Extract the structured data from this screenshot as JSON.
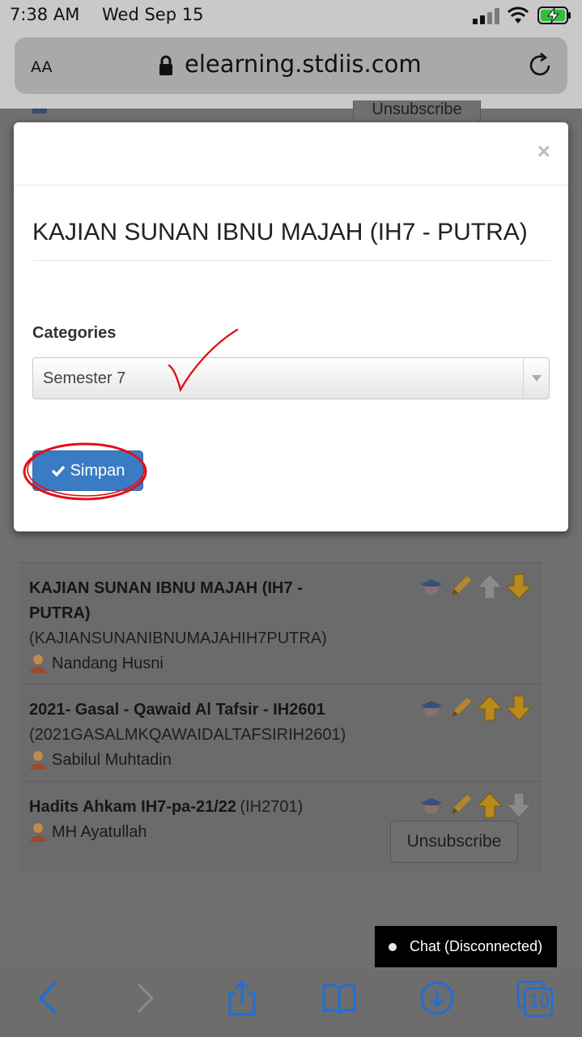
{
  "status": {
    "time": "7:38 AM",
    "date": "Wed Sep 15"
  },
  "browser": {
    "text_size_button": "AA",
    "url": "elearning.stdiis.com",
    "tab_count": "10"
  },
  "background_page": {
    "top_button": "Unsubscribe",
    "courses": [
      {
        "title": "KAJIAN SUNAN IBNU MAJAH (IH7 - PUTRA)",
        "code": "(KAJIANSUNANIBNUMAJAHIH7PUTRA)",
        "teacher": "Nandang Husni"
      },
      {
        "title": "2021- Gasal - Qawaid Al Tafsir - IH2601",
        "code": "(2021GASALMKQAWAIDALTAFSIRIH2601)",
        "teacher": "Sabilul Muhtadin"
      },
      {
        "title": "Hadits Ahkam IH7-pa-21/22",
        "code": "(IH2701)",
        "teacher": "MH Ayatullah",
        "button": "Unsubscribe"
      }
    ],
    "chat": "Chat (Disconnected)"
  },
  "modal": {
    "close": "×",
    "title": "KAJIAN SUNAN IBNU MAJAH (IH7 - PUTRA)",
    "category_label": "Categories",
    "category_value": "Semester 7",
    "save_label": "Simpan"
  },
  "colors": {
    "primary_button": "#3a7cc4",
    "annotation": "#e0101a",
    "ios_blue": "#1e6fd9"
  }
}
